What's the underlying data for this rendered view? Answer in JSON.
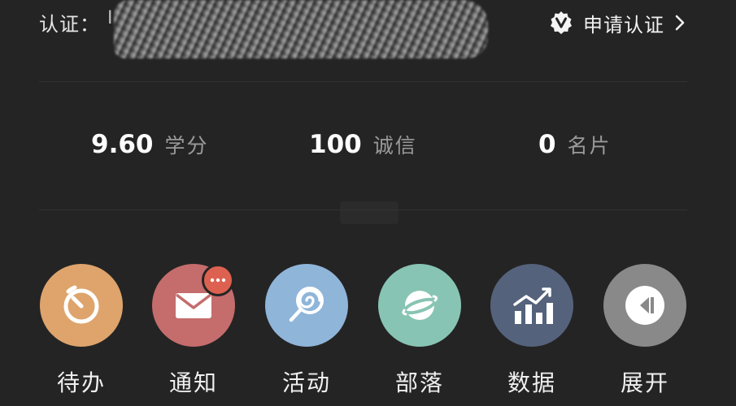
{
  "certification": {
    "label": "认证：",
    "value": "I",
    "apply_label": "申请认证",
    "badge_icon": "verified-v-badge-icon",
    "chevron_icon": "chevron-right-icon"
  },
  "stats": [
    {
      "value": "9.60",
      "label": "学分"
    },
    {
      "value": "100",
      "label": "诚信"
    },
    {
      "value": "0",
      "label": "名片"
    }
  ],
  "apps": [
    {
      "label": "待办",
      "icon": "timer-icon",
      "color": "#dea46c"
    },
    {
      "label": "通知",
      "icon": "envelope-icon",
      "color": "#c56c6c",
      "badge_icon": "more-dots-icon",
      "badge_color": "#dd6150"
    },
    {
      "label": "活动",
      "icon": "lollipop-icon",
      "color": "#8fb5d9"
    },
    {
      "label": "部落",
      "icon": "planet-icon",
      "color": "#88c4b3"
    },
    {
      "label": "数据",
      "icon": "bar-chart-icon",
      "color": "#55627c"
    },
    {
      "label": "展开",
      "icon": "expand-icon",
      "color": "#898989"
    }
  ]
}
